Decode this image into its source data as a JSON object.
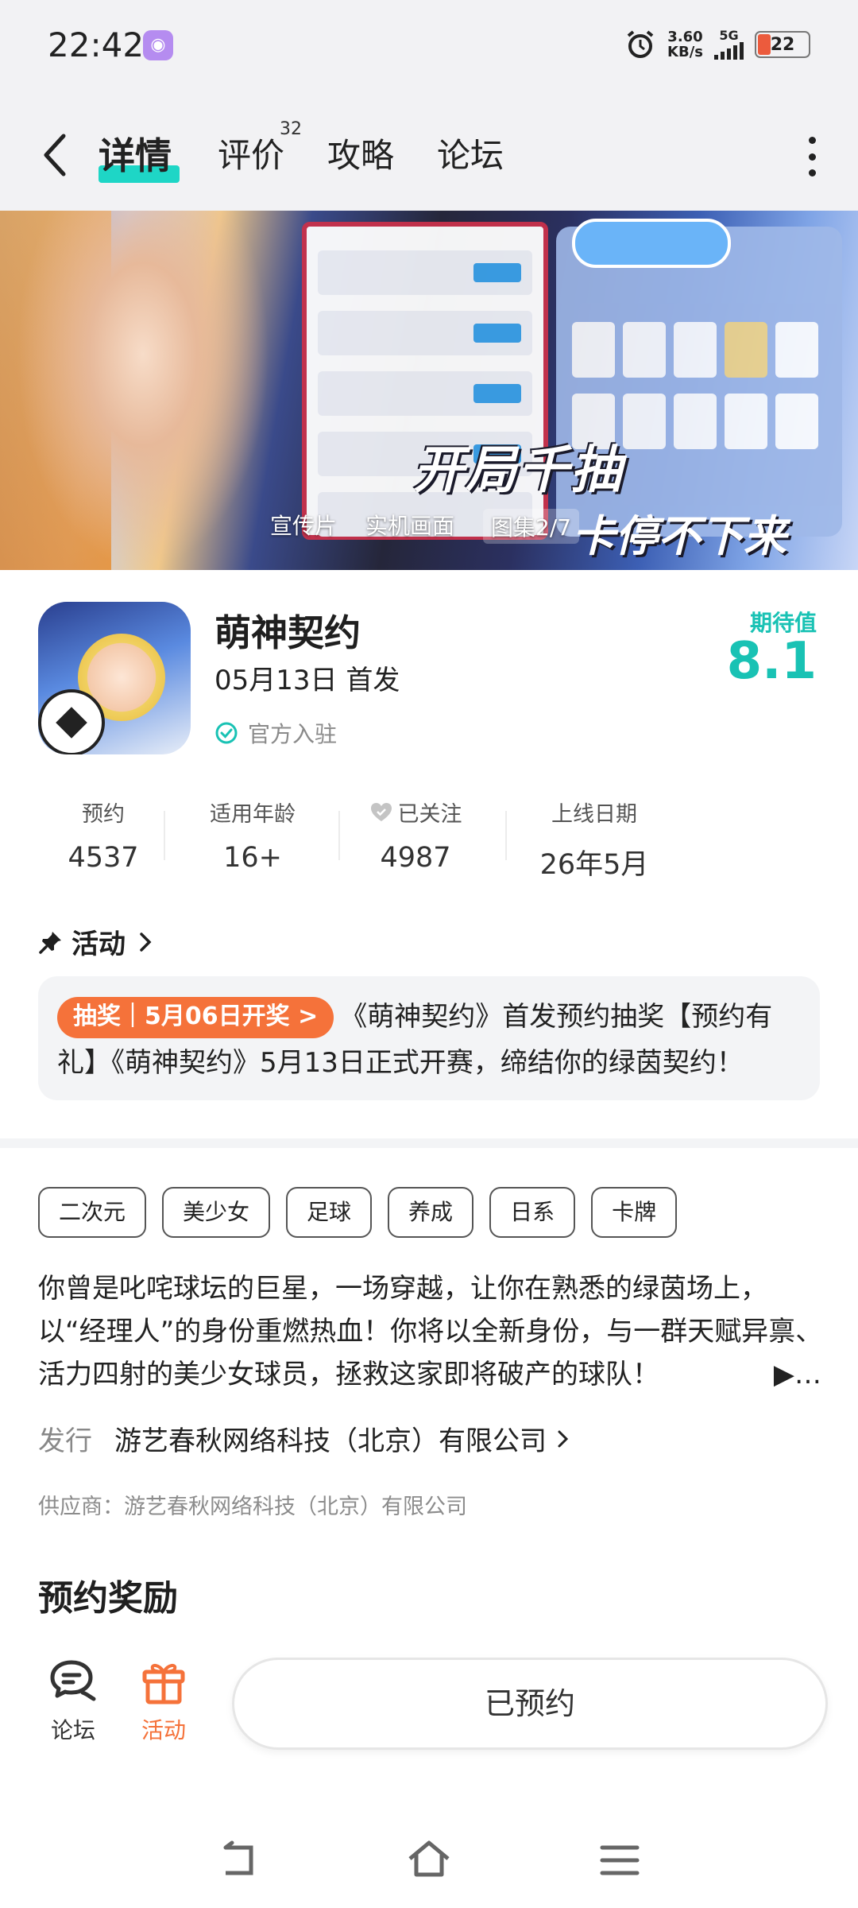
{
  "status_bar": {
    "time": "22:42",
    "net_speed_value": "3.60",
    "net_speed_unit": "KB/s",
    "network": "5G",
    "battery": "22"
  },
  "nav": {
    "tabs": [
      {
        "label": "详情",
        "active": true
      },
      {
        "label": "评价",
        "count": "32"
      },
      {
        "label": "攻略"
      },
      {
        "label": "论坛"
      }
    ]
  },
  "banner": {
    "tabs": [
      "宣传片",
      "实机画面",
      "图集2/7"
    ],
    "caption_line1": "开局千抽",
    "caption_line2": "卡停不下来"
  },
  "game": {
    "name": "萌神契约",
    "release": "05月13日 首发",
    "official": "官方入驻",
    "expect_label": "期待值",
    "expect_score": "8.1"
  },
  "stats": [
    {
      "label": "预约",
      "value": "4537"
    },
    {
      "label": "适用年龄",
      "value": "16+"
    },
    {
      "label": "已关注",
      "value": "4987"
    },
    {
      "label": "上线日期",
      "value": "26年5月"
    }
  ],
  "activity": {
    "title": "活动",
    "tag": "抽奖｜5月06日开奖 >",
    "text": "《萌神契约》首发预约抽奖【预约有礼】《萌神契约》5月13日正式开赛，缔结你的绿茵契约！"
  },
  "tags": [
    "二次元",
    "美少女",
    "足球",
    "养成",
    "日系",
    "卡牌"
  ],
  "description": {
    "text": "你曾是叱咤球坛的巨星，一场穿越，让你在熟悉的绿茵场上，以“经理人”的身份重燃热血！你将以全新身份，与一群天赋异禀、活力四射的美少女球员，拯救这家即将破产的球队！",
    "more": "▶…"
  },
  "publisher": {
    "key": "发行",
    "value": "游艺春秋网络科技（北京）有限公司"
  },
  "supplier": "供应商：游艺春秋网络科技（北京）有限公司",
  "reward_title": "预约奖励",
  "bottom_bar": {
    "forum_label": "论坛",
    "activity_label": "活动",
    "reserve_button": "已预约"
  },
  "colors": {
    "accent": "#19c2b4",
    "tab_underline": "#1ed6c6",
    "orange": "#f5723a"
  }
}
